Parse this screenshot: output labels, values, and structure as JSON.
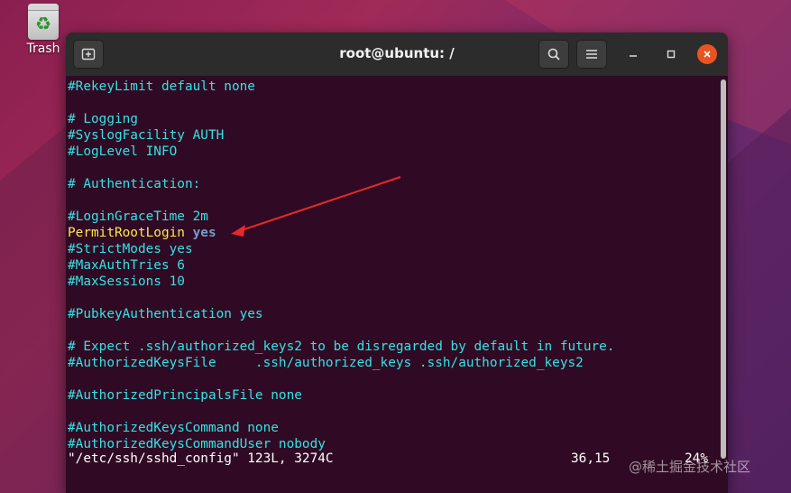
{
  "desktop": {
    "trash_label": "Trash",
    "trash_icon": "recycle-icon"
  },
  "window": {
    "title": "root@ubuntu: /",
    "buttons": [
      "new-tab-icon",
      "search-icon",
      "hamburger-menu-icon",
      "minimize-icon",
      "maximize-icon",
      "close-icon"
    ],
    "close_color": "#e95420"
  },
  "terminal": {
    "lines": [
      {
        "text": "#RekeyLimit default none",
        "color": "cyan"
      },
      {
        "text": "",
        "color": "none"
      },
      {
        "text": "# Logging",
        "color": "cyan"
      },
      {
        "text": "#SyslogFacility AUTH",
        "color": "cyan"
      },
      {
        "text": "#LogLevel INFO",
        "color": "cyan"
      },
      {
        "text": "",
        "color": "none"
      },
      {
        "text": "# Authentication:",
        "color": "cyan"
      },
      {
        "text": "",
        "color": "none"
      },
      {
        "text": "#LoginGraceTime 2m",
        "color": "cyan"
      },
      {
        "text": "PermitRootLogin",
        "value": "yes",
        "color": "yellow"
      },
      {
        "text": "#StrictModes yes",
        "color": "cyan"
      },
      {
        "text": "#MaxAuthTries 6",
        "color": "cyan"
      },
      {
        "text": "#MaxSessions 10",
        "color": "cyan"
      },
      {
        "text": "",
        "color": "none"
      },
      {
        "text": "#PubkeyAuthentication yes",
        "color": "cyan"
      },
      {
        "text": "",
        "color": "none"
      },
      {
        "text": "# Expect .ssh/authorized_keys2 to be disregarded by default in future.",
        "color": "cyan"
      },
      {
        "text": "#AuthorizedKeysFile     .ssh/authorized_keys .ssh/authorized_keys2",
        "color": "cyan"
      },
      {
        "text": "",
        "color": "none"
      },
      {
        "text": "#AuthorizedPrincipalsFile none",
        "color": "cyan"
      },
      {
        "text": "",
        "color": "none"
      },
      {
        "text": "#AuthorizedKeysCommand none",
        "color": "cyan"
      },
      {
        "text": "#AuthorizedKeysCommandUser nobody",
        "color": "cyan"
      }
    ],
    "status_file": "\"/etc/ssh/sshd_config\" 123L, 3274C",
    "status_pos": "36,15",
    "status_pct": "24%"
  },
  "annotation": {
    "arrow_color": "#e8282a"
  },
  "watermark": "@稀土掘金技术社区"
}
